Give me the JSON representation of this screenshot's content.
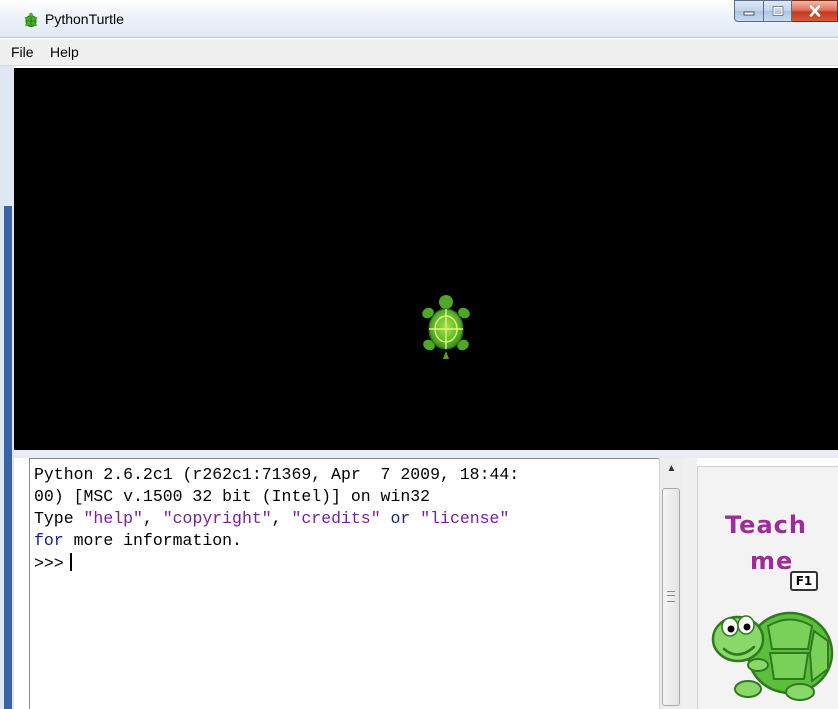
{
  "window": {
    "title": "PythonTurtle",
    "controls": {
      "minimize": "minimize",
      "maximize": "maximize",
      "close": "close"
    }
  },
  "menu": [
    {
      "label": "File"
    },
    {
      "label": "Help"
    }
  ],
  "canvas": {
    "background_color": "#000000",
    "turtle_icon": "green-turtle-icon"
  },
  "console": {
    "lines": [
      {
        "segments": [
          {
            "text": "Python 2.6.2c1 (r262c1:71369, Apr  7 2009, 18:44:",
            "style": "plain"
          }
        ]
      },
      {
        "segments": [
          {
            "text": "00) [MSC v.1500 32 bit (Intel)] on win32",
            "style": "plain"
          }
        ]
      },
      {
        "segments": [
          {
            "text": "Type ",
            "style": "plain"
          },
          {
            "text": "\"help\"",
            "style": "string"
          },
          {
            "text": ", ",
            "style": "plain"
          },
          {
            "text": "\"copyright\"",
            "style": "string"
          },
          {
            "text": ", ",
            "style": "plain"
          },
          {
            "text": "\"credits\"",
            "style": "string"
          },
          {
            "text": " ",
            "style": "plain"
          },
          {
            "text": "or",
            "style": "keyword"
          },
          {
            "text": " ",
            "style": "plain"
          },
          {
            "text": "\"license\"",
            "style": "string"
          }
        ]
      },
      {
        "segments": [
          {
            "text": "for",
            "style": "keyword"
          },
          {
            "text": " more information.",
            "style": "plain"
          }
        ]
      }
    ],
    "prompt": ">>>",
    "input_value": "",
    "colors": {
      "string": "#7a1f9a",
      "keyword": "#1a1a8c"
    }
  },
  "teach_panel": {
    "line1": "Teach",
    "line2": "me",
    "shortcut_key": "F1",
    "text_color": "#a02a9a",
    "mascot_icon": "cartoon-turtle-icon"
  }
}
